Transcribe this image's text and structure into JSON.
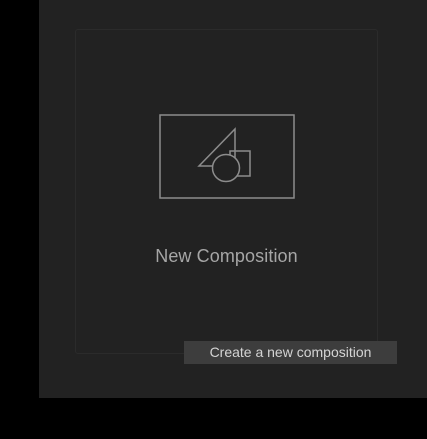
{
  "new_composition": {
    "label": "New Composition",
    "icon": "composition-shapes-icon"
  },
  "tooltip": {
    "text": "Create a new composition"
  },
  "colors": {
    "background": "#000000",
    "panel": "#222222",
    "card_border": "#2b2b2b",
    "icon_stroke": "#8c8c8c",
    "label": "#a6a6a6",
    "tooltip_bg": "#3d3d3d",
    "tooltip_text": "#d4d4d4"
  }
}
